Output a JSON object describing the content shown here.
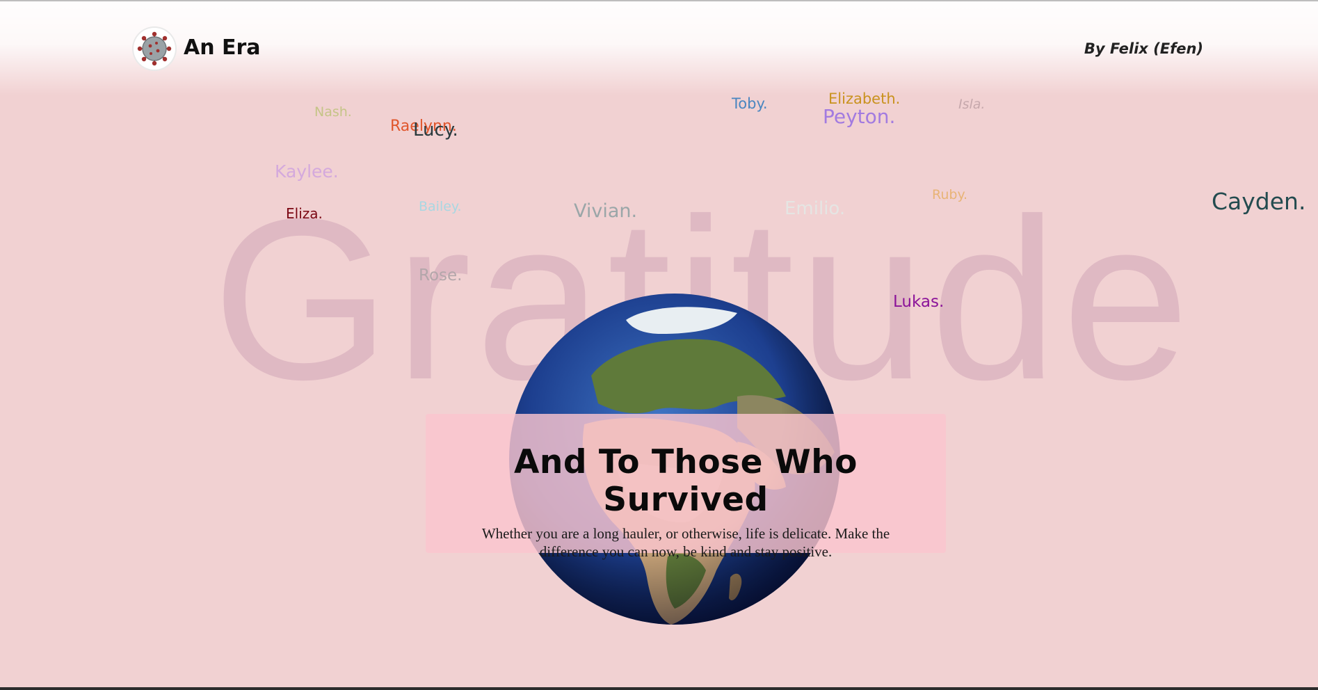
{
  "header": {
    "brand_name": "An Era",
    "author": "By Felix (Efen)",
    "logo_icon": "virus-icon"
  },
  "background_word": "Gratitude",
  "names": [
    {
      "label": "Nash.",
      "color": "#c5c487"
    },
    {
      "label": "Raelynn.",
      "color": "#e0562c"
    },
    {
      "label": "Lucy.",
      "color": "#2a3a3d"
    },
    {
      "label": "Toby.",
      "color": "#4a86c0"
    },
    {
      "label": "Elizabeth.",
      "color": "#c9921e"
    },
    {
      "label": "Peyton.",
      "color": "#a27be0"
    },
    {
      "label": "Isla.",
      "color": "#c6a8ac"
    },
    {
      "label": "Kaylee.",
      "color": "#d4a9dd"
    },
    {
      "label": "Eliza.",
      "color": "#7a0612"
    },
    {
      "label": "Bailey.",
      "color": "#a8d7e2"
    },
    {
      "label": "Vivian.",
      "color": "#9aa6a8"
    },
    {
      "label": "Emilio.",
      "color": "#e5e5e3"
    },
    {
      "label": "Ruby.",
      "color": "#e8b476"
    },
    {
      "label": "Cayden.",
      "color": "#234b4f"
    },
    {
      "label": "Rose.",
      "color": "#b3a6aa"
    },
    {
      "label": "Lukas.",
      "color": "#8b1399"
    }
  ],
  "hero": {
    "title": "And To Those Who Survived",
    "text": "Whether you are a long hauler, or otherwise, life is delicate. Make the difference you can now, be kind and stay positive."
  },
  "globe_icon": "earth-globe-icon"
}
